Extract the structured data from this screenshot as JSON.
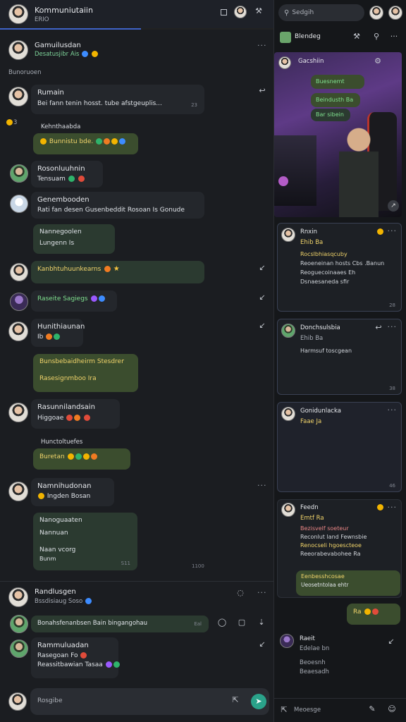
{
  "app": {
    "title": "Kommuniutaiin",
    "subtitle": "ERIO"
  },
  "search": {
    "placeholder": "Sedgih"
  },
  "header_right": {
    "title": "Blendeg"
  },
  "left_messages": [
    {
      "name": "Gamuilusdan",
      "sub": "Desatusjibr Ais",
      "caption": "Bunoruoen"
    },
    {
      "name": "Rumain",
      "text": "Bei fann tenin hosst. tube afstgeuplis...",
      "ts": "23"
    },
    {
      "caption": "Kehnthaabda",
      "text": "Bunnistu bde.",
      "side_count": "3"
    },
    {
      "name": "Rosonluuhnin",
      "text": "Tensuam"
    },
    {
      "name": "Genembooden",
      "text": "Rati fan desen   Gusenbeddit   Rosoan  Is   Gonude"
    },
    {
      "name": "Nannegoolen",
      "text": "Lungenn   Is"
    },
    {
      "text": "Kanbhtuhuunkearns"
    },
    {
      "text": "Raseite Sagiegs"
    },
    {
      "name": "Hunithiaunan",
      "text": "Ib"
    },
    {
      "line1": "Bunsbebaidheirm Stesdrem",
      "line2": "Rasesignmboo    Ira"
    },
    {
      "name": "Rasunnilandsain",
      "text": "Higgoae"
    },
    {
      "caption": "Hunctoltuefes",
      "text": "Buretan"
    },
    {
      "name": "Namnihudonan",
      "text": "Ingden   Bosan"
    },
    {
      "line1": "Nanoguaaten",
      "line2": "Nannuan",
      "line3": "Naan   vcorg",
      "line4": "Bunm",
      "ts": "S11",
      "ts2": "1100"
    },
    {
      "name": "Randlusgen",
      "sub": "Bssdisiaug  Soso"
    },
    {
      "text": "Bonahsfenanbsen  Bain bingangohau",
      "ts": "Eal"
    },
    {
      "name": "Rammuluadan",
      "line1": "Rasegoan  Fo",
      "line2": "Reassitbawian  Tasaa"
    }
  ],
  "composer": {
    "placeholder": "Rosgibe"
  },
  "video_card": {
    "name": "Gacshiin",
    "msgs": [
      "Buesnemt",
      "Beindusth  Ba",
      "Bar sibein"
    ]
  },
  "cards": [
    {
      "name": "Rnxin",
      "sub": "Ehib  Ba",
      "lines": [
        "Rocslbhiasqcuby",
        "Reoeneinan hosts Cbs .Banun",
        "Reoguecoinaaes Eh",
        "Dsnaesaneda sfir"
      ],
      "ts": "28"
    },
    {
      "name": "Donchsulsbia",
      "sub": "Ehib  Ba",
      "lines": [
        "Harmsuf toscgean"
      ],
      "ts": "38"
    },
    {
      "name": "Gonidunlacka",
      "sub": "Faae  Ja",
      "lines": [],
      "ts": "46"
    },
    {
      "name": "Feedn",
      "sub": "Emtf  Ra",
      "lines": [
        "Bezisvelf soeteur",
        "Reconlut land  Fewnsbie",
        "Renocseli hgoescteoe",
        "Reeorabevabohee Ra",
        "Ueosetntolaa ehtr"
      ],
      "ts": "28"
    }
  ],
  "right_bottom": {
    "reply_text": "Eenbesshcosae",
    "short_bubble": "Ra",
    "profile_name": "Raeit",
    "profile_sub": "Edelae bn",
    "profile_lines": [
      "Beoesnh",
      "Beaesadh"
    ],
    "footer": "Meoesge"
  }
}
